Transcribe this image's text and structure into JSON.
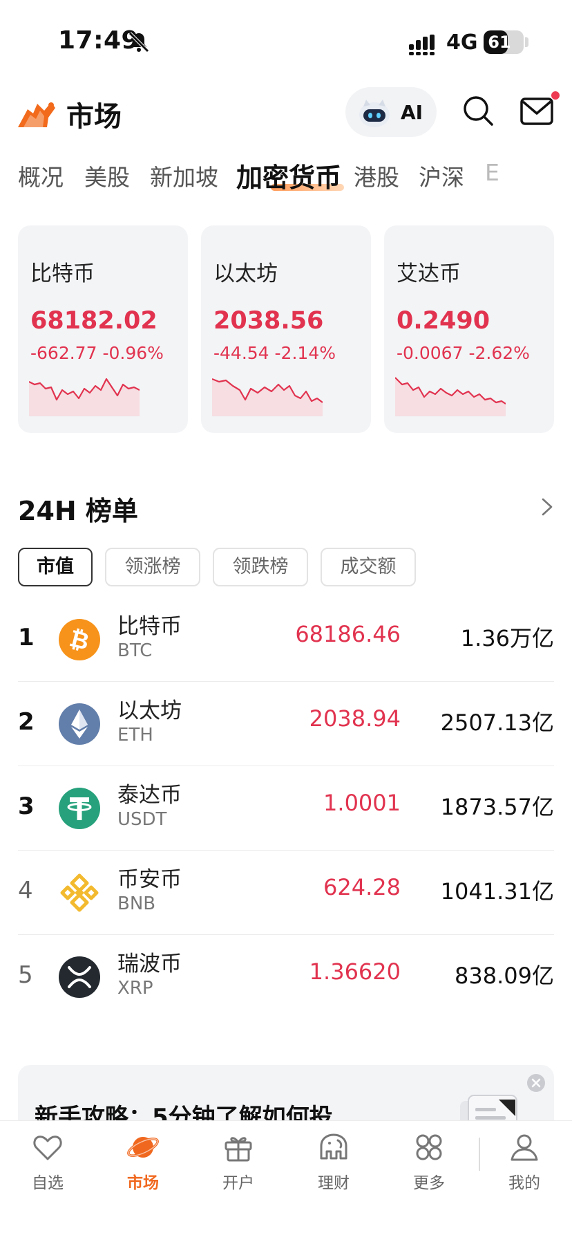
{
  "status_bar": {
    "time": "17:49",
    "network": "4G",
    "battery": "61",
    "battery_level": 0.61
  },
  "header": {
    "title": "市场",
    "ai_label": "AI"
  },
  "tabs": [
    {
      "label": "概况"
    },
    {
      "label": "美股"
    },
    {
      "label": "新加坡"
    },
    {
      "label": "加密货币",
      "active": true
    },
    {
      "label": "港股"
    },
    {
      "label": "沪深"
    },
    {
      "label": "E"
    }
  ],
  "cards": [
    {
      "name": "比特币",
      "price": "68182.02",
      "change": "-662.77 -0.96%"
    },
    {
      "name": "以太坊",
      "price": "2038.56",
      "change": "-44.54 -2.14%"
    },
    {
      "name": "艾达币",
      "price": "0.2490",
      "change": "-0.0067 -2.62%"
    }
  ],
  "ranking": {
    "title": "24H 榜单",
    "filters": [
      "市值",
      "领涨榜",
      "领跌榜",
      "成交额"
    ],
    "rows": [
      {
        "rank": "1",
        "name": "比特币",
        "code": "BTC",
        "price": "68186.46",
        "cap": "1.36万亿",
        "icon": "bitcoin-icon"
      },
      {
        "rank": "2",
        "name": "以太坊",
        "code": "ETH",
        "price": "2038.94",
        "cap": "2507.13亿",
        "icon": "ethereum-icon"
      },
      {
        "rank": "3",
        "name": "泰达币",
        "code": "USDT",
        "price": "1.0001",
        "cap": "1873.57亿",
        "icon": "tether-icon"
      },
      {
        "rank": "4",
        "name": "币安币",
        "code": "BNB",
        "price": "624.28",
        "cap": "1041.31亿",
        "icon": "bnb-icon"
      },
      {
        "rank": "5",
        "name": "瑞波币",
        "code": "XRP",
        "price": "1.36620",
        "cap": "838.09亿",
        "icon": "xrp-icon"
      }
    ]
  },
  "promo": {
    "text": "新手攻略：5分钟了解如何投"
  },
  "nav": [
    {
      "label": "自选",
      "icon": "heart-icon"
    },
    {
      "label": "市场",
      "icon": "planet-icon",
      "active": true
    },
    {
      "label": "开户",
      "icon": "gift-icon"
    },
    {
      "label": "理财",
      "icon": "elephant-icon"
    },
    {
      "label": "更多",
      "icon": "grid-icon"
    },
    {
      "label": "我的",
      "icon": "user-icon"
    }
  ],
  "colors": {
    "down": "#e1334f",
    "accent": "#f0681f",
    "card_bg": "#f3f4f6"
  }
}
